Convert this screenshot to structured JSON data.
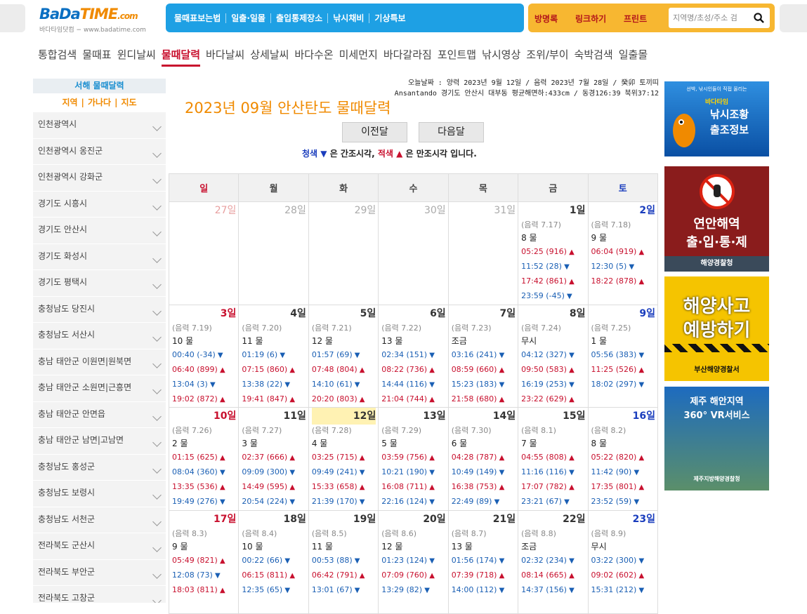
{
  "logo": {
    "part1": "BaDa",
    "part2": "TIME",
    "suffix": ".com",
    "sub": "바다타임닷컴 − www.badatime.com"
  },
  "topnav": [
    "물때표보는법",
    "일출·일몰",
    "출입통제장소",
    "낚시채비",
    "기상특보"
  ],
  "orangenav": [
    "방명록",
    "링크하기",
    "프린트"
  ],
  "search": {
    "placeholder": "지역명/초성/주소 검"
  },
  "menu": [
    "통합검색",
    "물때표",
    "윈디날씨",
    "물때달력",
    "바다날씨",
    "상세날씨",
    "바다수온",
    "미세먼지",
    "바다갈라짐",
    "포인트맵",
    "낚시영상",
    "조위/부이",
    "숙박검색",
    "일출몰"
  ],
  "menu_active": "물때달력",
  "sidebar": {
    "header": "서해 물때달력",
    "tabs": [
      "지역",
      "가나다",
      "지도"
    ],
    "items": [
      "인천광역시",
      "인천광역시 옹진군",
      "인천광역시 강화군",
      "경기도 시흥시",
      "경기도 안산시",
      "경기도 화성시",
      "경기도 평택시",
      "충청남도 당진시",
      "충청남도 서산시",
      "충남 태안군 이원면|원북면",
      "충남 태안군 소원면|근흥면",
      "충남 태안군 안면읍",
      "충남 태안군 남면|고남면",
      "충청남도 홍성군",
      "충청남도 보령시",
      "충청남도 서천군",
      "전라북도 군산시",
      "전라북도 부안군",
      "전라북도 고창군"
    ]
  },
  "info": {
    "line1": "오늘날짜 : 양력 2023년 9월 12일 / 음력 2023년 7월 28일 / 癸卯 토끼띠",
    "line2": "Ansantando 경기도 안산시 대부동 평균해면하:433cm / 동경126:39 북위37:12"
  },
  "title": "2023년 09월 안산탄도 물때달력",
  "prev_label": "이전달",
  "next_label": "다음달",
  "legend": {
    "blue": "청색",
    "mid": "은 간조시각,",
    "red": "적색",
    "tail": "은 만조시각 입니다."
  },
  "weekdays": [
    "일",
    "월",
    "화",
    "수",
    "목",
    "금",
    "토"
  ],
  "weeks": [
    [
      {
        "d": "27일",
        "o": true
      },
      {
        "d": "28일",
        "o": true
      },
      {
        "d": "29일",
        "o": true
      },
      {
        "d": "30일",
        "o": true
      },
      {
        "d": "31일",
        "o": true
      },
      {
        "d": "1일",
        "lunar": "(음력 7.17)",
        "mul": "8 물",
        "t": [
          [
            "05:25 (916)",
            "h"
          ],
          [
            "11:52 (28)",
            "l"
          ],
          [
            "17:42 (861)",
            "h"
          ],
          [
            "23:59 (-45)",
            "l"
          ]
        ]
      },
      {
        "d": "2일",
        "lunar": "(음력 7.18)",
        "mul": "9 물",
        "t": [
          [
            "06:04 (919)",
            "h"
          ],
          [
            "12:30 (5)",
            "l"
          ],
          [
            "18:22 (878)",
            "h"
          ]
        ]
      }
    ],
    [
      {
        "d": "3일",
        "lunar": "(음력 7.19)",
        "mul": "10 물",
        "t": [
          [
            "00:40 (-34)",
            "l"
          ],
          [
            "06:40 (899)",
            "h"
          ],
          [
            "13:04 (3)",
            "l"
          ],
          [
            "19:02 (872)",
            "h"
          ]
        ]
      },
      {
        "d": "4일",
        "lunar": "(음력 7.20)",
        "mul": "11 물",
        "t": [
          [
            "01:19 (6)",
            "l"
          ],
          [
            "07:15 (860)",
            "h"
          ],
          [
            "13:38 (22)",
            "l"
          ],
          [
            "19:41 (847)",
            "h"
          ]
        ]
      },
      {
        "d": "5일",
        "lunar": "(음력 7.21)",
        "mul": "12 물",
        "t": [
          [
            "01:57 (69)",
            "l"
          ],
          [
            "07:48 (804)",
            "h"
          ],
          [
            "14:10 (61)",
            "l"
          ],
          [
            "20:20 (803)",
            "h"
          ]
        ]
      },
      {
        "d": "6일",
        "lunar": "(음력 7.22)",
        "mul": "13 물",
        "t": [
          [
            "02:34 (151)",
            "l"
          ],
          [
            "08:22 (736)",
            "h"
          ],
          [
            "14:44 (116)",
            "l"
          ],
          [
            "21:04 (744)",
            "h"
          ]
        ]
      },
      {
        "d": "7일",
        "lunar": "(음력 7.23)",
        "mul": "조금",
        "t": [
          [
            "03:16 (241)",
            "l"
          ],
          [
            "08:59 (660)",
            "h"
          ],
          [
            "15:23 (183)",
            "l"
          ],
          [
            "21:58 (680)",
            "h"
          ]
        ]
      },
      {
        "d": "8일",
        "lunar": "(음력 7.24)",
        "mul": "무시",
        "t": [
          [
            "04:12 (327)",
            "l"
          ],
          [
            "09:50 (583)",
            "h"
          ],
          [
            "16:19 (253)",
            "l"
          ],
          [
            "23:22 (629)",
            "h"
          ]
        ]
      },
      {
        "d": "9일",
        "lunar": "(음력 7.25)",
        "mul": "1 물",
        "t": [
          [
            "05:56 (383)",
            "l"
          ],
          [
            "11:25 (526)",
            "h"
          ],
          [
            "18:02 (297)",
            "l"
          ]
        ]
      }
    ],
    [
      {
        "d": "10일",
        "lunar": "(음력 7.26)",
        "mul": "2 물",
        "t": [
          [
            "01:15 (625)",
            "h"
          ],
          [
            "08:04 (360)",
            "l"
          ],
          [
            "13:35 (536)",
            "h"
          ],
          [
            "19:49 (276)",
            "l"
          ]
        ]
      },
      {
        "d": "11일",
        "lunar": "(음력 7.27)",
        "mul": "3 물",
        "t": [
          [
            "02:37 (666)",
            "h"
          ],
          [
            "09:09 (300)",
            "l"
          ],
          [
            "14:49 (595)",
            "h"
          ],
          [
            "20:54 (224)",
            "l"
          ]
        ]
      },
      {
        "d": "12일",
        "lunar": "(음력 7.28)",
        "mul": "4 물",
        "today": true,
        "t": [
          [
            "03:25 (715)",
            "h"
          ],
          [
            "09:49 (241)",
            "l"
          ],
          [
            "15:33 (658)",
            "h"
          ],
          [
            "21:39 (170)",
            "l"
          ]
        ]
      },
      {
        "d": "13일",
        "lunar": "(음력 7.29)",
        "mul": "5 물",
        "t": [
          [
            "03:59 (756)",
            "h"
          ],
          [
            "10:21 (190)",
            "l"
          ],
          [
            "16:08 (711)",
            "h"
          ],
          [
            "22:16 (124)",
            "l"
          ]
        ]
      },
      {
        "d": "14일",
        "lunar": "(음력 7.30)",
        "mul": "6 물",
        "t": [
          [
            "04:28 (787)",
            "h"
          ],
          [
            "10:49 (149)",
            "l"
          ],
          [
            "16:38 (753)",
            "h"
          ],
          [
            "22:49 (89)",
            "l"
          ]
        ]
      },
      {
        "d": "15일",
        "lunar": "(음력 8.1)",
        "mul": "7 물",
        "t": [
          [
            "04:55 (808)",
            "h"
          ],
          [
            "11:16 (116)",
            "l"
          ],
          [
            "17:07 (782)",
            "h"
          ],
          [
            "23:21 (67)",
            "l"
          ]
        ]
      },
      {
        "d": "16일",
        "lunar": "(음력 8.2)",
        "mul": "8 물",
        "t": [
          [
            "05:22 (820)",
            "h"
          ],
          [
            "11:42 (90)",
            "l"
          ],
          [
            "17:35 (801)",
            "h"
          ],
          [
            "23:52 (59)",
            "l"
          ]
        ]
      }
    ],
    [
      {
        "d": "17일",
        "lunar": "(음력 8.3)",
        "mul": "9 물",
        "t": [
          [
            "05:49 (821)",
            "h"
          ],
          [
            "12:08 (73)",
            "l"
          ],
          [
            "18:03 (811)",
            "h"
          ]
        ]
      },
      {
        "d": "18일",
        "lunar": "(음력 8.4)",
        "mul": "10 물",
        "t": [
          [
            "00:22 (66)",
            "l"
          ],
          [
            "06:15 (811)",
            "h"
          ],
          [
            "12:35 (65)",
            "l"
          ]
        ]
      },
      {
        "d": "19일",
        "lunar": "(음력 8.5)",
        "mul": "11 물",
        "t": [
          [
            "00:53 (88)",
            "l"
          ],
          [
            "06:42 (791)",
            "h"
          ],
          [
            "13:01 (67)",
            "l"
          ]
        ]
      },
      {
        "d": "20일",
        "lunar": "(음력 8.6)",
        "mul": "12 물",
        "t": [
          [
            "01:23 (124)",
            "l"
          ],
          [
            "07:09 (760)",
            "h"
          ],
          [
            "13:29 (82)",
            "l"
          ]
        ]
      },
      {
        "d": "21일",
        "lunar": "(음력 8.7)",
        "mul": "13 물",
        "t": [
          [
            "01:56 (174)",
            "l"
          ],
          [
            "07:39 (718)",
            "h"
          ],
          [
            "14:00 (112)",
            "l"
          ]
        ]
      },
      {
        "d": "22일",
        "lunar": "(음력 8.8)",
        "mul": "조금",
        "t": [
          [
            "02:32 (234)",
            "l"
          ],
          [
            "08:14 (665)",
            "h"
          ],
          [
            "14:37 (156)",
            "l"
          ]
        ]
      },
      {
        "d": "23일",
        "lunar": "(음력 8.9)",
        "mul": "무시",
        "t": [
          [
            "03:22 (300)",
            "l"
          ],
          [
            "09:02 (602)",
            "h"
          ],
          [
            "15:31 (212)",
            "l"
          ]
        ]
      }
    ]
  ],
  "ads": [
    {
      "name": "fishing-ad",
      "small": "선박, 낚시인들이 직접 올리는",
      "sub": "바다타임",
      "big1": "낚시조황",
      "big2": "출조정보"
    },
    {
      "name": "coast-restrict-ad",
      "big1": "연안해역",
      "big2": "출·입·통·제",
      "foot": "해양경찰청"
    },
    {
      "name": "marine-safety-ad",
      "big1": "해양사고",
      "big2": "예방하기",
      "foot": "부산해양경찰서"
    },
    {
      "name": "jeju-vr-ad",
      "big1": "제주 해안지역",
      "big2": "360° VR서비스",
      "foot": "제주지방해양경찰청"
    }
  ],
  "colors": {
    "accent_blue": "#1ea0e4",
    "accent_orange": "#f7b731",
    "high_tide": "#c8102e",
    "low_tide": "#1a5fb4",
    "title": "#f08a00"
  }
}
